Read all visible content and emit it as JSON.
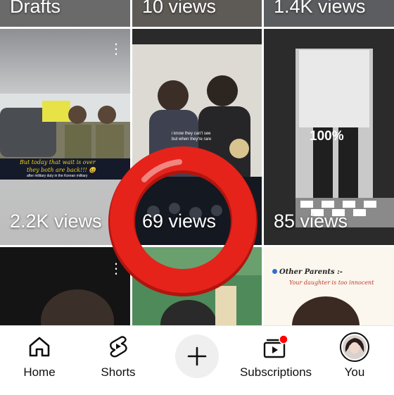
{
  "top_row": [
    {
      "label": "Drafts"
    },
    {
      "label": "10 views"
    },
    {
      "label": "1.4K views"
    }
  ],
  "grid": [
    {
      "views": "2.2K views",
      "caption_line1": "But today that wait is over",
      "caption_line2": "they both are back!!! 😆",
      "caption_sub": "after military duty in the Korean military"
    },
    {
      "views": "69 views",
      "caption_line1": "i know they can't see",
      "caption_line2": "but when they're rare"
    },
    {
      "views": "85 views",
      "overlay": "100%"
    }
  ],
  "bottom_row": [
    {
      "kind": "dark"
    },
    {
      "kind": "green"
    },
    {
      "kind": "text",
      "caption_line1": "Other Parents :-",
      "caption_line2": "Your daughter is too innocent"
    }
  ],
  "colors": {
    "record_ring": "#e5231b",
    "notification_dot": "#ff0000",
    "caption_yellow": "#f2d21a",
    "caption_red": "#c0392b"
  },
  "nav": {
    "items": [
      {
        "label": "Home",
        "icon": "home-icon"
      },
      {
        "label": "Shorts",
        "icon": "shorts-icon"
      },
      {
        "label": "",
        "icon": "create-plus-icon"
      },
      {
        "label": "Subscriptions",
        "icon": "subscriptions-icon"
      },
      {
        "label": "You",
        "icon": "avatar"
      }
    ]
  }
}
